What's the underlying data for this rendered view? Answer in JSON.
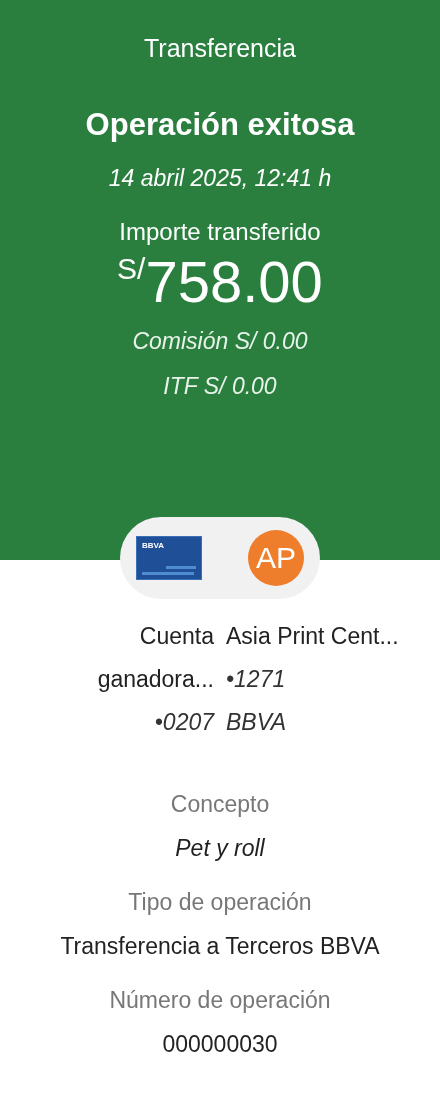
{
  "header": {
    "title": "Transferencia",
    "status": "Operación exitosa",
    "datetime": "14 abril 2025, 12:41 h",
    "amount_label": "Importe transferido",
    "currency": "S/",
    "amount": "758.00",
    "fees": [
      "Comisión  S/ 0.00",
      "ITF  S/ 0.00"
    ]
  },
  "parties": {
    "origin": {
      "card_label": "BBVA",
      "lines": [
        "Cuenta",
        "ganadora...",
        "•0207"
      ]
    },
    "destination": {
      "initials": "AP",
      "lines": [
        "Asia Print Cent...",
        "•1271",
        "BBVA"
      ]
    }
  },
  "details": [
    {
      "label": "Concepto",
      "value": "Pet y roll",
      "italic": true
    },
    {
      "label": "Tipo de operación",
      "value": "Transferencia a Terceros BBVA",
      "italic": false
    },
    {
      "label": "Número de operación",
      "value": "000000030",
      "italic": false
    }
  ]
}
